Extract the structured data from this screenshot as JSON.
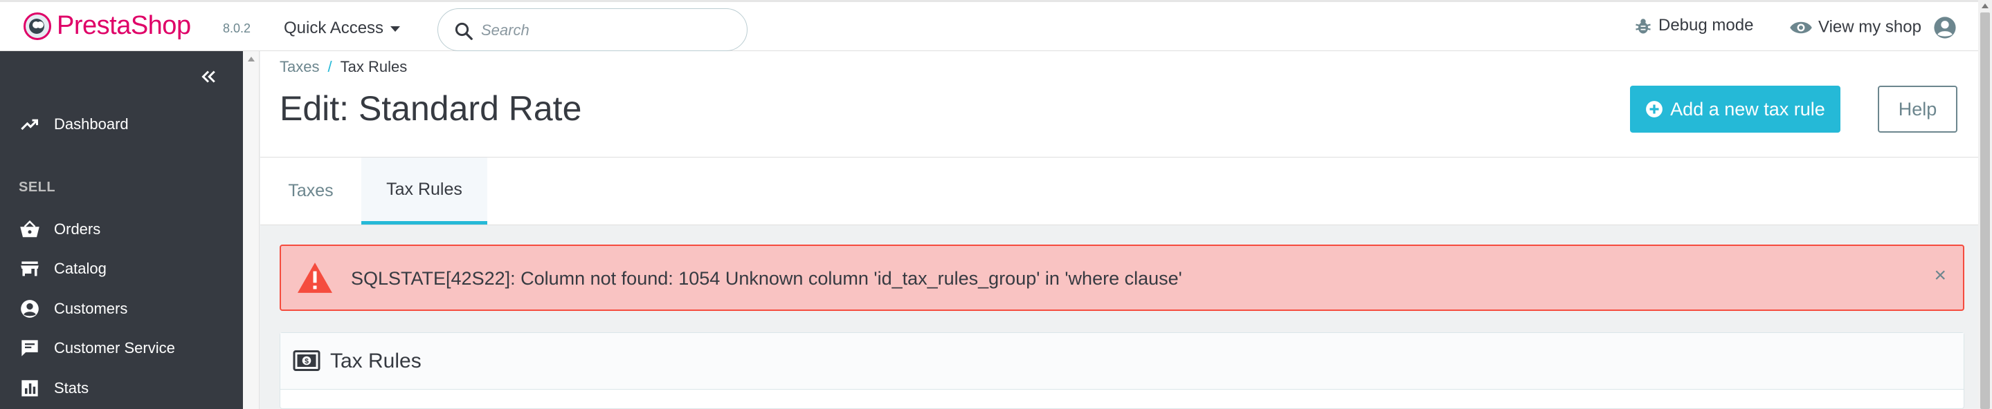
{
  "header": {
    "brand": "PrestaShop",
    "version": "8.0.2",
    "quick_access_label": "Quick Access",
    "search_placeholder": "Search",
    "debug_label": "Debug mode",
    "view_shop_label": "View my shop"
  },
  "sidebar": {
    "dashboard_label": "Dashboard",
    "section_sell": "SELL",
    "items": [
      {
        "label": "Orders",
        "icon": "basket-icon"
      },
      {
        "label": "Catalog",
        "icon": "store-icon"
      },
      {
        "label": "Customers",
        "icon": "account-circle-icon"
      },
      {
        "label": "Customer Service",
        "icon": "chat-icon"
      },
      {
        "label": "Stats",
        "icon": "bar-chart-icon"
      }
    ]
  },
  "page": {
    "breadcrumb": [
      "Taxes",
      "Tax Rules"
    ],
    "breadcrumb_sep": "/",
    "title": "Edit: Standard Rate",
    "add_button_label": "Add a new tax rule",
    "help_button_label": "Help"
  },
  "tabs": [
    "Taxes",
    "Tax Rules"
  ],
  "alert": {
    "message": "SQLSTATE[42S22]: Column not found: 1054 Unknown column 'id_tax_rules_group' in 'where clause'",
    "close_glyph": "×"
  },
  "panel": {
    "title": "Tax Rules"
  },
  "colors": {
    "brand": "#df0067",
    "accent": "#25b9d7",
    "sidebar_bg": "#363a41",
    "alert_bg": "#f9c3c2",
    "alert_border": "#f54c3e"
  }
}
